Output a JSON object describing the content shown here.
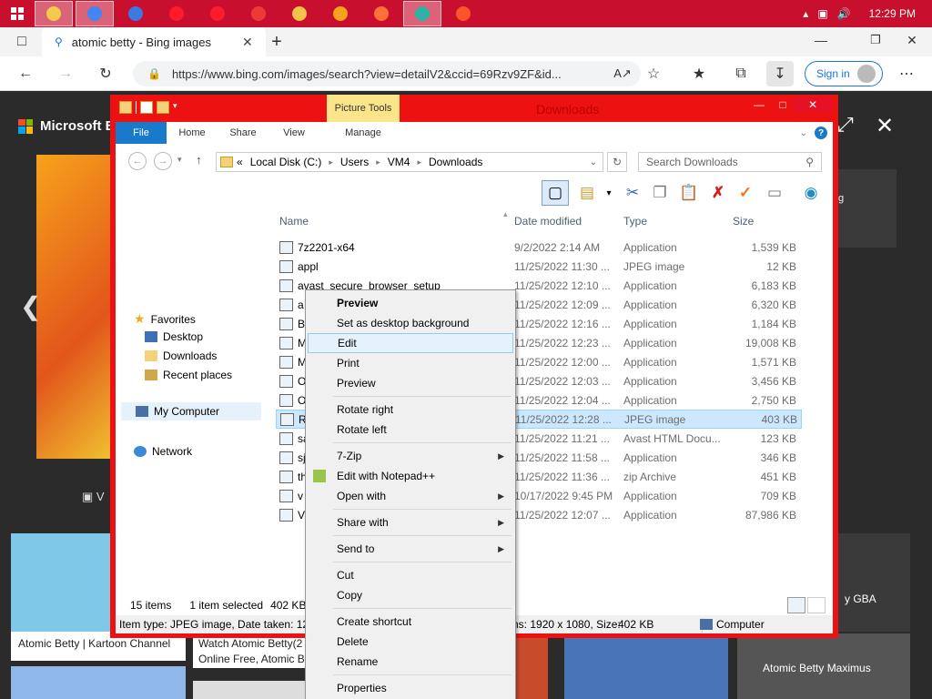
{
  "taskbar": {
    "time": "12:29 PM",
    "apps": [
      {
        "name": "file-explorer",
        "color": "#f5c94a",
        "active": true
      },
      {
        "name": "chrome",
        "color": "#4285f4",
        "active": true
      },
      {
        "name": "globe",
        "color": "#3b7be0",
        "active": false
      },
      {
        "name": "opera",
        "color": "#ff1b2d",
        "active": false
      },
      {
        "name": "opera-gx",
        "color": "#ff1b2d",
        "active": false
      },
      {
        "name": "vivaldi",
        "color": "#ef3939",
        "active": false
      },
      {
        "name": "chrome-beta",
        "color": "#f3c24a",
        "active": false
      },
      {
        "name": "chrome-canary",
        "color": "#f7a21b",
        "active": false
      },
      {
        "name": "firefox",
        "color": "#ff7139",
        "active": false
      },
      {
        "name": "edge",
        "color": "#2fb2a6",
        "active": true
      },
      {
        "name": "brave",
        "color": "#fb542b",
        "active": false
      }
    ]
  },
  "browser": {
    "tab_title": "atomic betty - Bing images",
    "url": "https://www.bing.com/images/search?view=detailV2&ccid=69Rzv9ZF&id...",
    "sign_in": "Sign in"
  },
  "bing": {
    "logo_text": "Microsoft Bi",
    "right_card_text": "g",
    "thumbs": [
      {
        "caption": "Atomic Betty | Kartoon Channel"
      },
      {
        "caption": "Watch Atomic Betty(2"
      },
      {
        "caption": "Online Free, Atomic B"
      },
      {
        "caption": "y GBA"
      },
      {
        "caption": "Atomic Betty Maximus"
      }
    ],
    "visual_search_fragment": "V"
  },
  "explorer": {
    "title": "Downloads",
    "picture_tools": "Picture Tools",
    "ribbon_tabs": [
      "File",
      "Home",
      "Share",
      "View",
      "Manage"
    ],
    "breadcrumb": [
      "Local Disk (C:)",
      "Users",
      "VM4",
      "Downloads"
    ],
    "breadcrumb_prefix": "«",
    "search_placeholder": "Search Downloads",
    "nav": {
      "favorites": "Favorites",
      "desktop": "Desktop",
      "downloads": "Downloads",
      "recent": "Recent places",
      "mycomputer": "My Computer",
      "network": "Network"
    },
    "columns": {
      "name": "Name",
      "date": "Date modified",
      "type": "Type",
      "size": "Size"
    },
    "files": [
      {
        "name": "7z2201-x64",
        "date": "9/2/2022 2:14 AM",
        "type": "Application",
        "size": "1,539 KB",
        "selected": false
      },
      {
        "name": "appl",
        "date": "11/25/2022 11:30 ...",
        "type": "JPEG image",
        "size": "12 KB",
        "selected": false
      },
      {
        "name": "avast_secure_browser_setup",
        "date": "11/25/2022 12:10 ...",
        "type": "Application",
        "size": "6,183 KB",
        "selected": false
      },
      {
        "name": "a",
        "date": "11/25/2022 12:09 ...",
        "type": "Application",
        "size": "6,320 KB",
        "selected": false
      },
      {
        "name": "B",
        "date": "11/25/2022 12:16 ...",
        "type": "Application",
        "size": "1,184 KB",
        "selected": false
      },
      {
        "name": "M",
        "date": "11/25/2022 12:23 ...",
        "type": "Application",
        "size": "19,008 KB",
        "selected": false
      },
      {
        "name": "M",
        "date": "11/25/2022 12:00 ...",
        "type": "Application",
        "size": "1,571 KB",
        "selected": false
      },
      {
        "name": "O",
        "date": "11/25/2022 12:03 ...",
        "type": "Application",
        "size": "3,456 KB",
        "selected": false
      },
      {
        "name": "O",
        "date": "11/25/2022 12:04 ...",
        "type": "Application",
        "size": "2,750 KB",
        "selected": false
      },
      {
        "name": "R",
        "date": "11/25/2022 12:28 ...",
        "type": "JPEG image",
        "size": "403 KB",
        "selected": true
      },
      {
        "name": "sa",
        "date": "11/25/2022 11:21 ...",
        "type": "Avast HTML Docu...",
        "size": "123 KB",
        "selected": false
      },
      {
        "name": "sj",
        "date": "11/25/2022 11:58 ...",
        "type": "Application",
        "size": "346 KB",
        "selected": false
      },
      {
        "name": "th",
        "date": "11/25/2022 11:36 ...",
        "type": "zip Archive",
        "size": "451 KB",
        "selected": false
      },
      {
        "name": "v",
        "date": "10/17/2022 9:45 PM",
        "type": "Application",
        "size": "709 KB",
        "selected": false
      },
      {
        "name": "V",
        "date": "11/25/2022 12:07 ...",
        "type": "Application",
        "size": "87,986 KB",
        "selected": false
      }
    ],
    "status": {
      "count": "15 items",
      "selected": "1 item selected",
      "size": "402 KB"
    },
    "details": {
      "left": "Item type: JPEG image, Date taken: 12/",
      "middle": "ns: 1920 x 1080, Size:",
      "size": "402 KB",
      "location": "Computer"
    }
  },
  "context_menu": {
    "items": [
      {
        "label": "Preview",
        "bold": true
      },
      {
        "label": "Set as desktop background"
      },
      {
        "label": "Edit",
        "hl": true
      },
      {
        "label": "Print"
      },
      {
        "label": "Preview"
      },
      {
        "label": "Rotate right"
      },
      {
        "label": "Rotate left"
      },
      {
        "label": "7-Zip",
        "sub": true
      },
      {
        "label": "Edit with Notepad++",
        "icon": true
      },
      {
        "label": "Open with",
        "sub": true
      },
      {
        "label": "Share with",
        "sub": true
      },
      {
        "label": "Send to",
        "sub": true
      },
      {
        "label": "Cut"
      },
      {
        "label": "Copy"
      },
      {
        "label": "Create shortcut"
      },
      {
        "label": "Delete"
      },
      {
        "label": "Rename"
      },
      {
        "label": "Properties"
      }
    ]
  }
}
